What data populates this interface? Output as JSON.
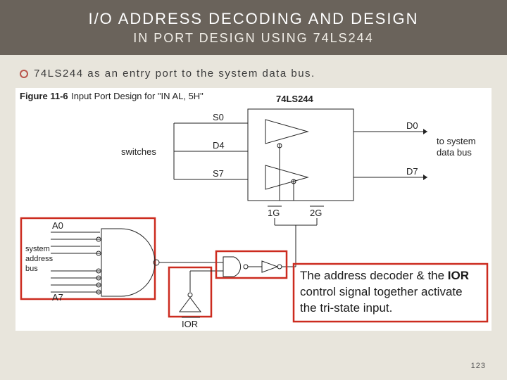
{
  "header": {
    "title": "I/O ADDRESS DECODING AND DESIGN",
    "subtitle": "IN PORT DESIGN USING 74LS244"
  },
  "bullet": {
    "text": "74LS244 as an entry port to the system data bus."
  },
  "figure": {
    "caption_prefix": "Figure 11-6",
    "caption_rest": " Input Port Design for \"IN AL, 5H\"",
    "chip_label": "74LS244",
    "left_signals": {
      "s0": "S0",
      "d4": "D4",
      "s7": "S7"
    },
    "right_signals": {
      "d0": "D0",
      "d7": "D7"
    },
    "enable_pins": {
      "g1": "1G",
      "g2": "2G"
    },
    "switches_label": "switches",
    "to_bus_line1": "to system",
    "to_bus_line2": "data bus",
    "addr_top": "A0",
    "addr_bot": "A7",
    "addr_label_line1": "system",
    "addr_label_line2": "address",
    "addr_label_line3": "bus",
    "ior": "IOR",
    "callout_line1": "The address decoder & the ",
    "callout_bold": "IOR",
    "callout_line2": "control signal together activate",
    "callout_line3": "the tri-state input."
  },
  "page_number": "123"
}
